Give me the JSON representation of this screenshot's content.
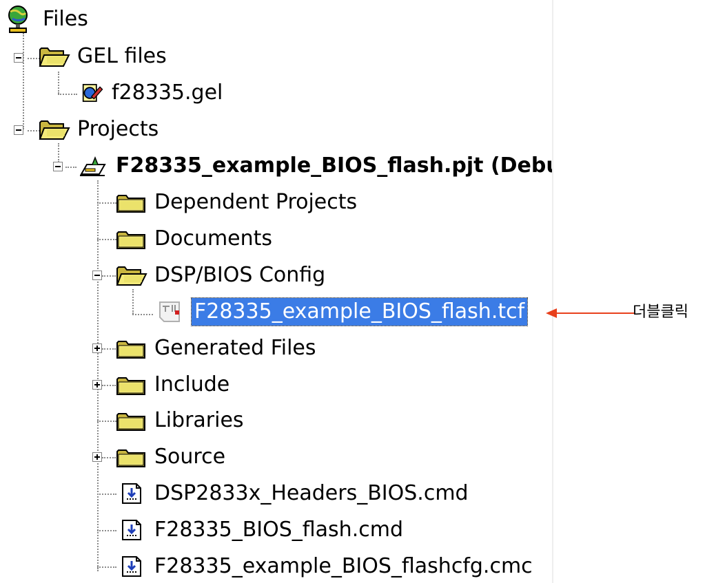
{
  "tree": {
    "root": {
      "label": "Files",
      "icon": "files-globe-icon"
    },
    "gel_folder": {
      "label": "GEL files",
      "icon": "open-folder-icon"
    },
    "gel_file": {
      "label": "f28335.gel",
      "icon": "gel-file-icon"
    },
    "projects_folder": {
      "label": "Projects",
      "icon": "open-folder-icon"
    },
    "project": {
      "label": "F28335_example_BIOS_flash.pjt (Debu",
      "icon": "project-icon"
    },
    "items": [
      {
        "label": "Dependent Projects",
        "icon": "folder-icon",
        "expander": "none"
      },
      {
        "label": "Documents",
        "icon": "folder-icon",
        "expander": "none"
      },
      {
        "label": "DSP/BIOS Config",
        "icon": "open-folder-icon",
        "expander": "minus"
      },
      {
        "label": "F28335_example_BIOS_flash.tcf",
        "icon": "config-file-icon",
        "selected": true
      },
      {
        "label": "Generated Files",
        "icon": "folder-icon",
        "expander": "plus"
      },
      {
        "label": "Include",
        "icon": "folder-icon",
        "expander": "plus"
      },
      {
        "label": "Libraries",
        "icon": "folder-icon",
        "expander": "none"
      },
      {
        "label": "Source",
        "icon": "folder-icon",
        "expander": "plus"
      },
      {
        "label": "DSP2833x_Headers_BIOS.cmd",
        "icon": "cmd-file-icon",
        "expander": "none"
      },
      {
        "label": "F28335_BIOS_flash.cmd",
        "icon": "cmd-file-icon",
        "expander": "none"
      },
      {
        "label": "F28335_example_BIOS_flashcfg.cmc",
        "icon": "cmd-file-icon",
        "expander": "none"
      }
    ]
  },
  "annotation": {
    "text": "더블클릭",
    "arrow_color": "#e8401c"
  },
  "colors": {
    "selection": "#3b7ce6",
    "folder_yellow": "#f0e070"
  }
}
